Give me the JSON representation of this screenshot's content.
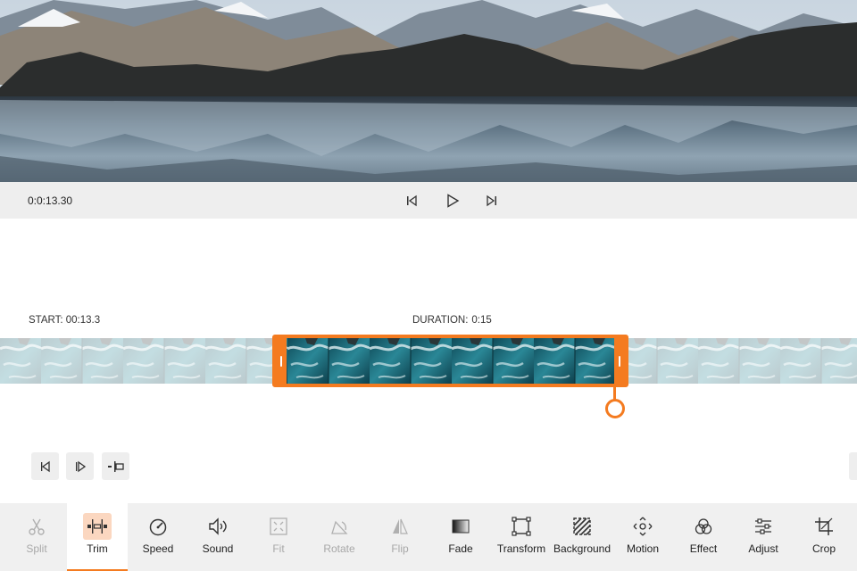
{
  "player": {
    "time": "0:0:13.30",
    "controls": {
      "prev": "skip-back-icon",
      "play": "play-icon",
      "next": "skip-forward-icon"
    }
  },
  "timeline": {
    "start_label": "START: 00:13.3",
    "duration_label": "DURATION:",
    "duration_value": "0:15"
  },
  "edit_buttons": [
    "step-back-frame-icon",
    "step-forward-frame-icon",
    "split-at-playhead-icon"
  ],
  "colors": {
    "accent": "#f47b20",
    "active_icon_bg": "#fbd7c0",
    "toolbar_bg": "#f0f0f0",
    "player_bar_bg": "#eeeeee"
  },
  "toolbar": {
    "tools": [
      {
        "label": "Split",
        "icon": "scissors-icon",
        "disabled": true
      },
      {
        "label": "Trim",
        "icon": "trim-icon",
        "active": true
      },
      {
        "label": "Speed",
        "icon": "speedometer-icon"
      },
      {
        "label": "Sound",
        "icon": "speaker-icon"
      },
      {
        "label": "Fit",
        "icon": "fit-frame-icon",
        "disabled": true
      },
      {
        "label": "Rotate",
        "icon": "rotate-icon",
        "disabled": true
      },
      {
        "label": "Flip",
        "icon": "flip-icon",
        "disabled": true
      },
      {
        "label": "Fade",
        "icon": "fade-gradient-icon"
      },
      {
        "label": "Transform",
        "icon": "transform-box-icon"
      },
      {
        "label": "Background",
        "icon": "background-hatch-icon"
      },
      {
        "label": "Motion",
        "icon": "motion-arrows-icon"
      },
      {
        "label": "Effect",
        "icon": "effect-circles-icon"
      },
      {
        "label": "Adjust",
        "icon": "adjust-sliders-icon"
      },
      {
        "label": "Crop",
        "icon": "crop-icon"
      }
    ]
  }
}
